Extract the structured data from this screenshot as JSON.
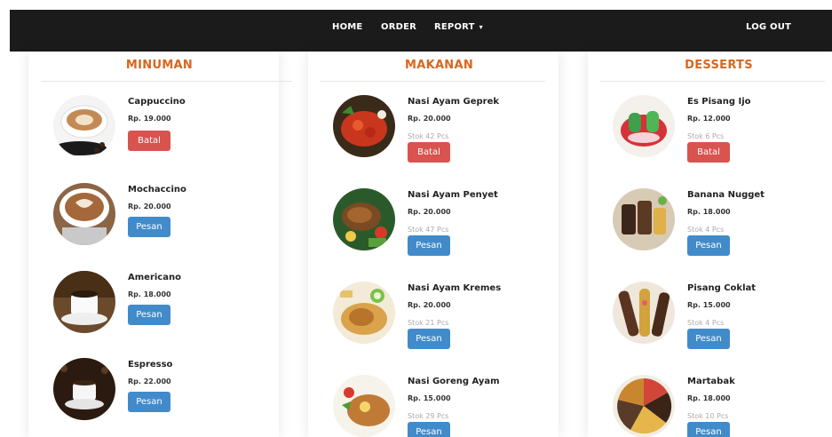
{
  "nav": {
    "home": "HOME",
    "order": "ORDER",
    "report": "REPORT",
    "logout": "LOG OUT"
  },
  "colors": {
    "navbar": "#1b1b1b",
    "heading": "#d9661e",
    "batal": "#d9534f",
    "pesan": "#428bca"
  },
  "minuman": {
    "title": "MINUMAN",
    "items": [
      {
        "name": "Cappuccino",
        "price": "Rp. 19.000",
        "button": "Batal",
        "image": "cappuccino-photo"
      },
      {
        "name": "Mochaccino",
        "price": "Rp. 20.000",
        "button": "Pesan",
        "image": "mochaccino-photo"
      },
      {
        "name": "Americano",
        "price": "Rp. 18.000",
        "button": "Pesan",
        "image": "americano-photo"
      },
      {
        "name": "Espresso",
        "price": "Rp. 22.000",
        "button": "Pesan",
        "image": "espresso-photo"
      }
    ]
  },
  "makanan": {
    "title": "MAKANAN",
    "items": [
      {
        "name": "Nasi Ayam Geprek",
        "price": "Rp. 20.000",
        "stock": "Stok 42 Pcs",
        "button": "Batal",
        "image": "ayam-geprek-photo"
      },
      {
        "name": "Nasi Ayam Penyet",
        "price": "Rp. 20.000",
        "stock": "Stok 47 Pcs",
        "button": "Pesan",
        "image": "ayam-penyet-photo"
      },
      {
        "name": "Nasi Ayam Kremes",
        "price": "Rp. 20.000",
        "stock": "Stok 21 Pcs",
        "button": "Pesan",
        "image": "ayam-kremes-photo"
      },
      {
        "name": "Nasi Goreng Ayam",
        "price": "Rp. 15.000",
        "stock": "Stok 29 Pcs",
        "button": "Pesan",
        "image": "nasi-goreng-photo"
      }
    ]
  },
  "desserts": {
    "title": "DESSERTS",
    "items": [
      {
        "name": "Es Pisang Ijo",
        "price": "Rp. 12.000",
        "stock": "Stok 6 Pcs",
        "button": "Batal",
        "image": "es-pisang-ijo-photo"
      },
      {
        "name": "Banana Nugget",
        "price": "Rp. 18.000",
        "stock": "Stok 4 Pcs",
        "button": "Pesan",
        "image": "banana-nugget-photo"
      },
      {
        "name": "Pisang Coklat",
        "price": "Rp. 15.000",
        "stock": "Stok 4 Pcs",
        "button": "Pesan",
        "image": "pisang-coklat-photo"
      },
      {
        "name": "Martabak",
        "price": "Rp. 18.000",
        "stock": "Stok 10 Pcs",
        "button": "Pesan",
        "image": "martabak-photo"
      }
    ]
  }
}
